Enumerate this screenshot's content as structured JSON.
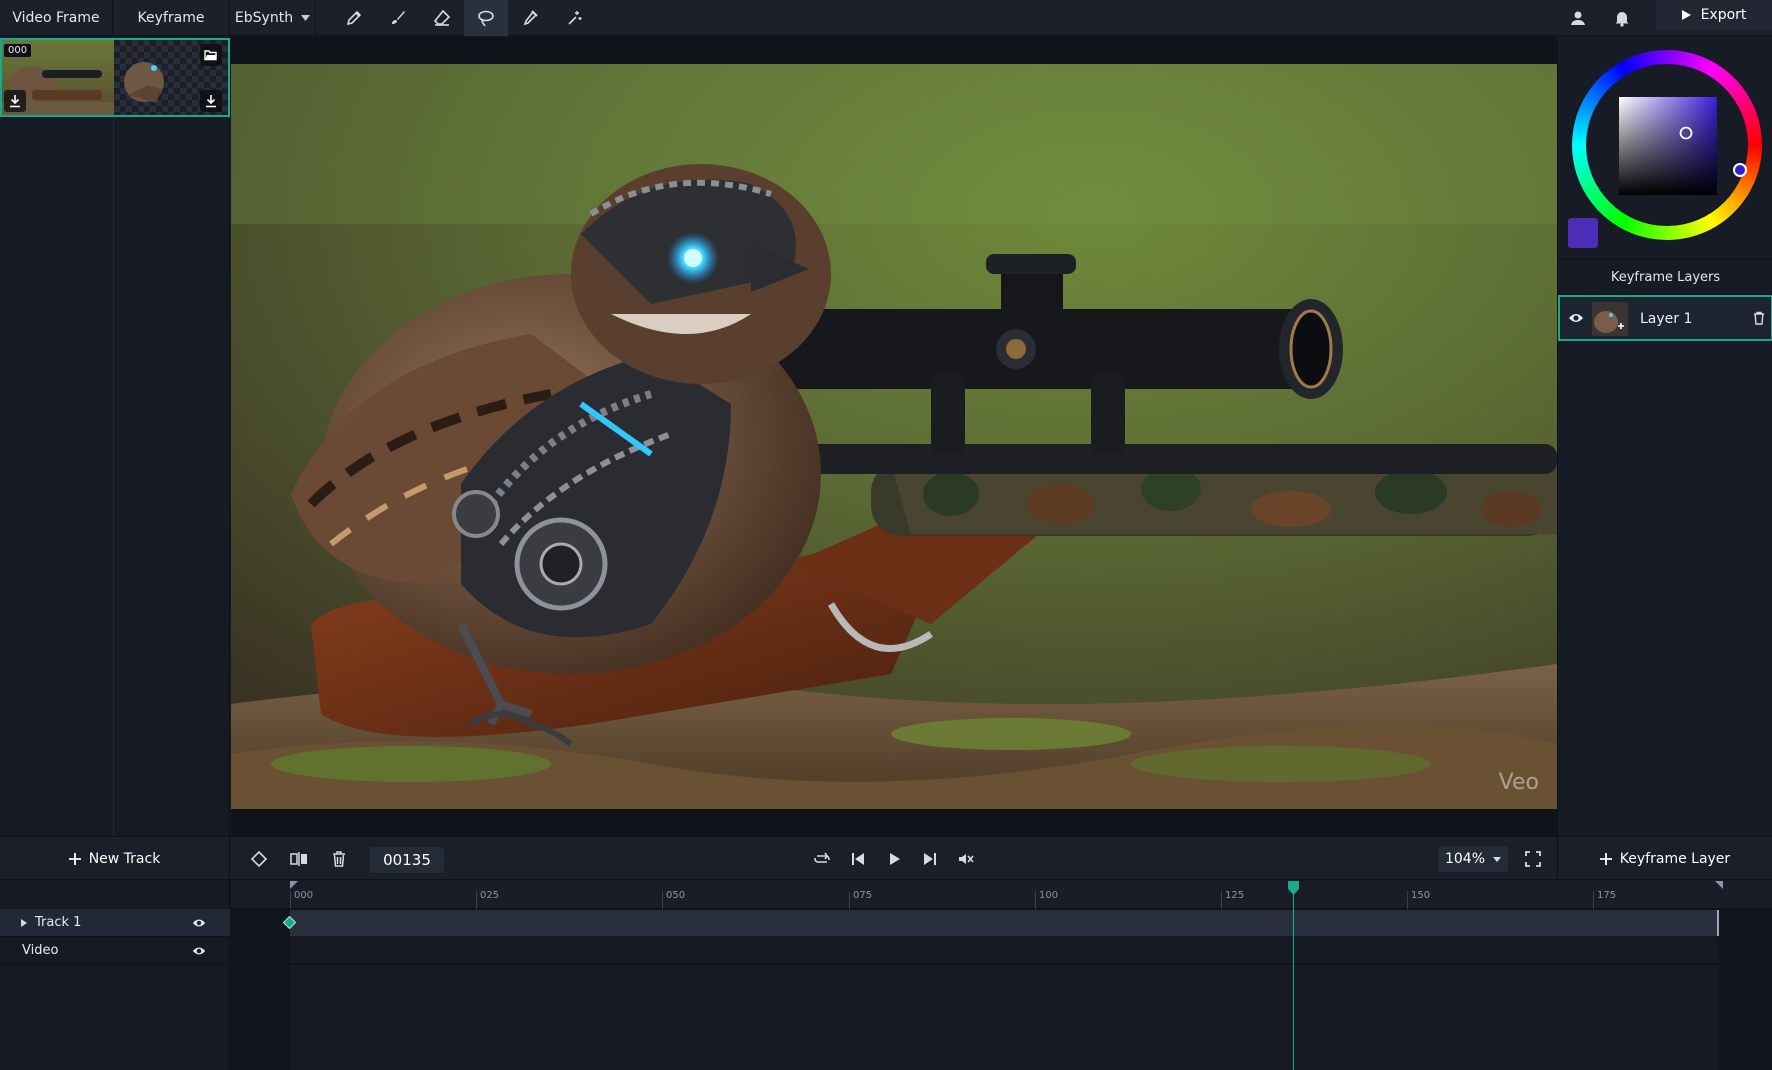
{
  "topbar": {
    "tabs": [
      "Video Frame",
      "Keyframe"
    ],
    "mode_select": "EbSynth",
    "tools": [
      "pen-icon",
      "brush-icon",
      "eraser-icon",
      "lasso-icon",
      "eyedropper-icon",
      "magic-wand-icon"
    ],
    "active_tool": "lasso-icon",
    "export_label": "Export"
  },
  "left_panel": {
    "frame_badge": "000"
  },
  "preview": {
    "watermark": "Veo"
  },
  "right_panel": {
    "layers_title": "Keyframe Layers",
    "layers": [
      {
        "name": "Layer 1"
      }
    ],
    "current_color": "#4b2db8"
  },
  "bottom_bar": {
    "new_track_label": "New Track",
    "frame_counter": "00135",
    "zoom": "104%",
    "keyframe_layer_label": "Keyframe Layer"
  },
  "timeline": {
    "ruler_labels": [
      "000",
      "025",
      "050",
      "075",
      "100",
      "125",
      "150",
      "175"
    ],
    "tracks": [
      {
        "name": "Track 1",
        "expandable": true
      },
      {
        "name": "Video",
        "expandable": false
      }
    ],
    "current_frame": 135
  },
  "colors": {
    "accent": "#1aa98a",
    "panel": "#171b25",
    "background": "#10131a"
  }
}
